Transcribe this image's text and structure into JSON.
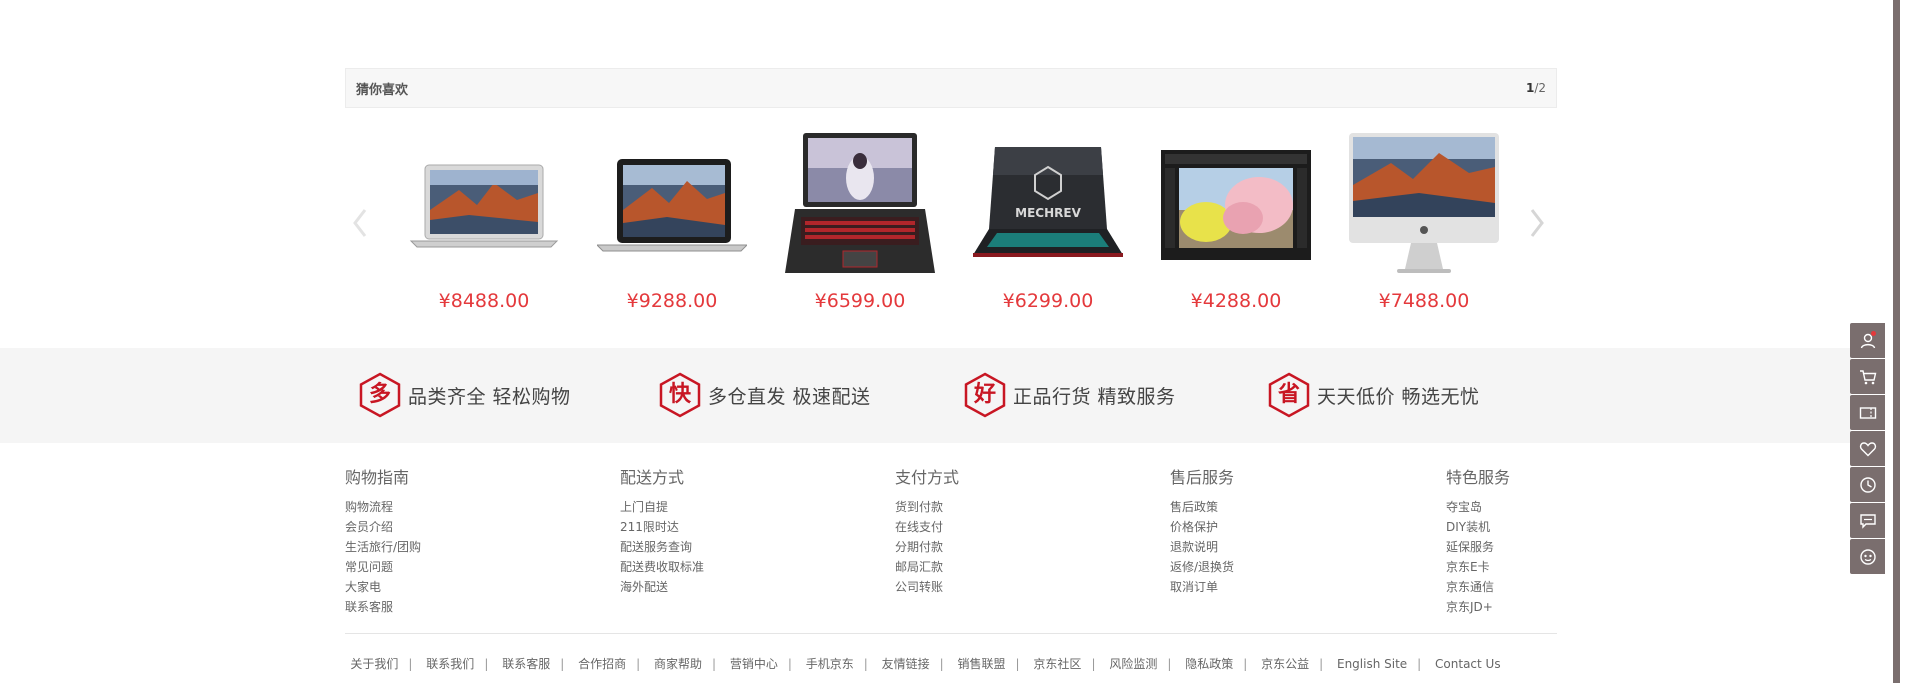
{
  "guess": {
    "title": "猜你喜欢",
    "page_current": "1",
    "page_total": "/2",
    "products": [
      {
        "price": "¥8488.00",
        "icon": "macbook-air-laptop"
      },
      {
        "price": "¥9288.00",
        "icon": "macbook-pro-laptop"
      },
      {
        "price": "¥6599.00",
        "icon": "gaming-laptop-red"
      },
      {
        "price": "¥6299.00",
        "icon": "mechrevo-gaming-laptop"
      },
      {
        "price": "¥4288.00",
        "icon": "laptop-cherry-blossom-screen"
      },
      {
        "price": "¥7488.00",
        "icon": "imac-desktop"
      }
    ]
  },
  "services": [
    {
      "badge": "多",
      "text": "品类齐全  轻松购物"
    },
    {
      "badge": "快",
      "text": "多仓直发  极速配送"
    },
    {
      "badge": "好",
      "text": "正品行货  精致服务"
    },
    {
      "badge": "省",
      "text": "天天低价  畅选无忧"
    }
  ],
  "footer_columns": [
    {
      "title": "购物指南",
      "items": [
        "购物流程",
        "会员介绍",
        "生活旅行/团购",
        "常见问题",
        "大家电",
        "联系客服"
      ]
    },
    {
      "title": "配送方式",
      "items": [
        "上门自提",
        "211限时达",
        "配送服务查询",
        "配送费收取标准",
        "海外配送"
      ]
    },
    {
      "title": "支付方式",
      "items": [
        "货到付款",
        "在线支付",
        "分期付款",
        "邮局汇款",
        "公司转账"
      ]
    },
    {
      "title": "售后服务",
      "items": [
        "售后政策",
        "价格保护",
        "退款说明",
        "返修/退换货",
        "取消订单"
      ]
    },
    {
      "title": "特色服务",
      "items": [
        "夺宝岛",
        "DIY装机",
        "延保服务",
        "京东E卡",
        "京东通信",
        "京东JD+"
      ]
    }
  ],
  "bottom_links": [
    "关于我们",
    "联系我们",
    "联系客服",
    "合作招商",
    "商家帮助",
    "营销中心",
    "手机京东",
    "友情链接",
    "销售联盟",
    "京东社区",
    "风险监测",
    "隐私政策",
    "京东公益",
    "English Site",
    "Contact Us"
  ],
  "toolbar": [
    "user-icon",
    "cart-icon",
    "coupon-icon",
    "favorite-icon",
    "history-icon",
    "message-icon",
    "jimi-icon"
  ],
  "colors": {
    "price": "#e4393c",
    "badge": "#c81623",
    "toolbar": "#7a6e6e"
  }
}
